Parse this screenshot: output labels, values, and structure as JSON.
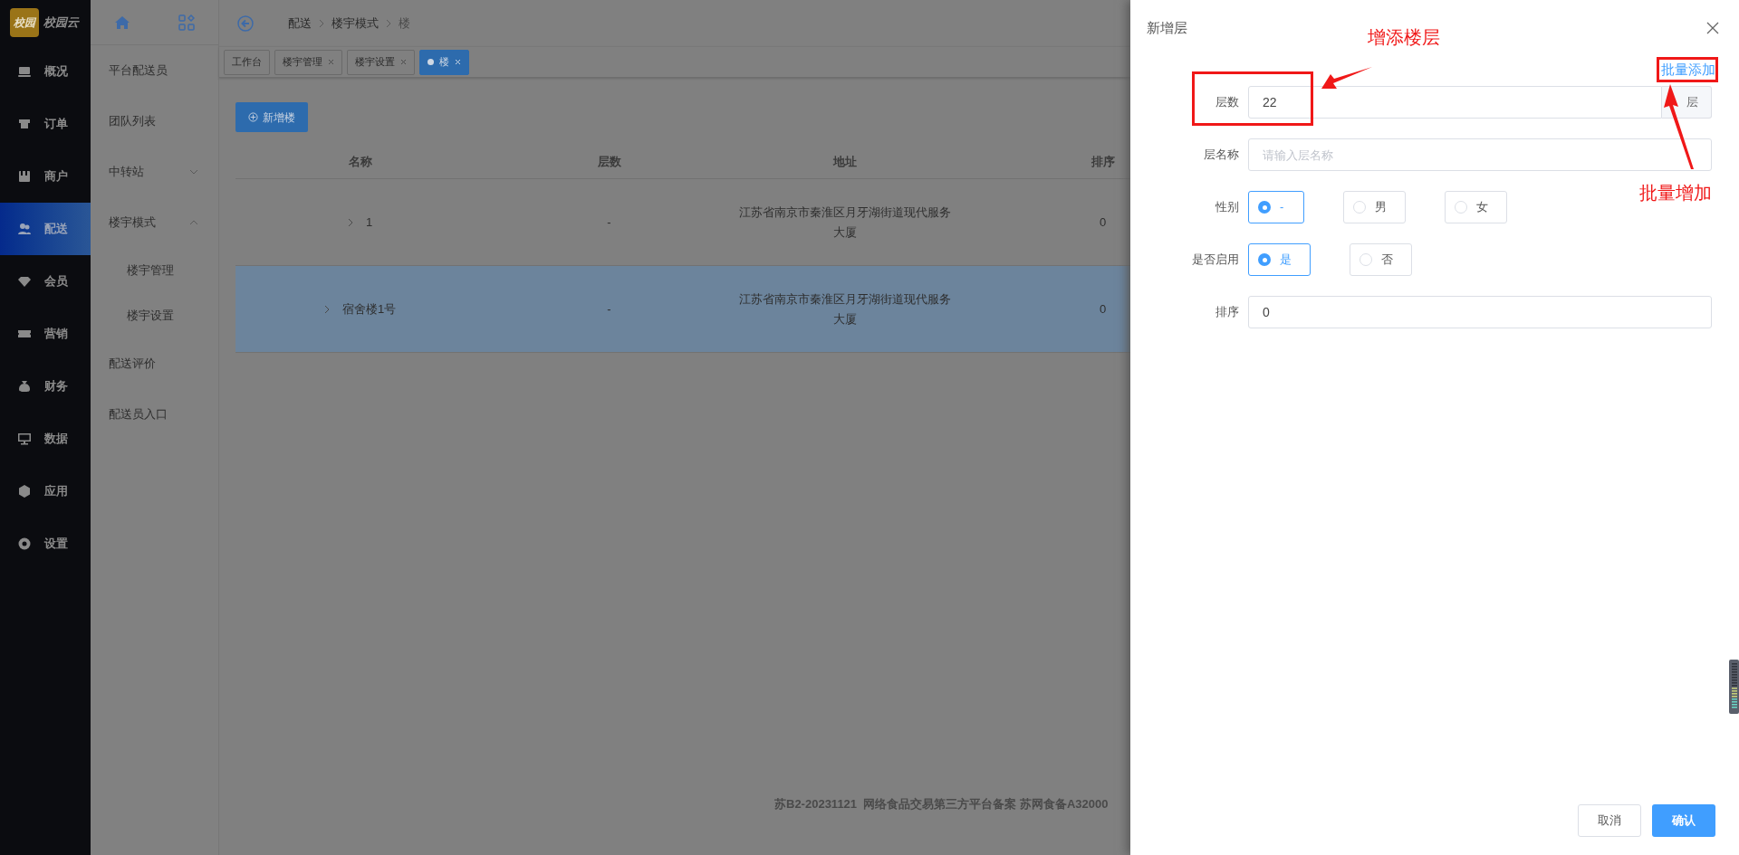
{
  "sidebar": {
    "logo_mark": "校园",
    "logo_text": "校园云",
    "items": [
      {
        "label": "概况",
        "selected": false
      },
      {
        "label": "订单",
        "selected": false
      },
      {
        "label": "商户",
        "selected": false
      },
      {
        "label": "配送",
        "selected": true
      },
      {
        "label": "会员",
        "selected": false
      },
      {
        "label": "营销",
        "selected": false
      },
      {
        "label": "财务",
        "selected": false
      },
      {
        "label": "数据",
        "selected": false
      },
      {
        "label": "应用",
        "selected": false
      },
      {
        "label": "设置",
        "selected": false
      }
    ]
  },
  "submenu": {
    "items": [
      {
        "label": "平台配送员"
      },
      {
        "label": "团队列表"
      },
      {
        "label": "中转站",
        "expanded": false
      },
      {
        "label": "楼宇模式",
        "expanded": true,
        "children": [
          {
            "label": "楼宇管理"
          },
          {
            "label": "楼宇设置"
          }
        ]
      },
      {
        "label": "配送评价"
      },
      {
        "label": "配送员入口"
      }
    ]
  },
  "breadcrumb": [
    "配送",
    "楼宇模式",
    "楼"
  ],
  "tabs": [
    {
      "label": "工作台",
      "selected": false,
      "closable": false
    },
    {
      "label": "楼宇管理",
      "selected": false,
      "closable": true
    },
    {
      "label": "楼宇设置",
      "selected": false,
      "closable": true
    },
    {
      "label": "楼",
      "selected": true,
      "closable": true
    }
  ],
  "add_button": "新增楼",
  "table": {
    "columns": [
      "名称",
      "层数",
      "地址",
      "排序"
    ],
    "rows": [
      {
        "highlighted": false,
        "cells": [
          "1",
          "-",
          "江苏省南京市秦淮区月牙湖街道现代服务大厦",
          "0"
        ]
      },
      {
        "highlighted": true,
        "cells": [
          "宿舍楼1号",
          "-",
          "江苏省南京市秦淮区月牙湖街道现代服务大厦",
          "0"
        ]
      }
    ]
  },
  "footer": "苏B2-20231121  网络食品交易第三方平台备案 苏网食备A32000",
  "drawer": {
    "title": "新增层",
    "batch_link": "批量添加",
    "fields": [
      {
        "kind": "input",
        "label": "层数",
        "value": "22",
        "suffix": "层"
      },
      {
        "kind": "input",
        "label": "层名称",
        "placeholder": "请输入层名称"
      },
      {
        "kind": "radio",
        "label": "性别",
        "options": [
          {
            "label": "-",
            "selected": true
          },
          {
            "label": "男",
            "selected": false
          },
          {
            "label": "女",
            "selected": false
          }
        ]
      },
      {
        "kind": "radio",
        "label": "是否启用",
        "options": [
          {
            "label": "是",
            "selected": true
          },
          {
            "label": "否",
            "selected": false
          }
        ]
      },
      {
        "kind": "input",
        "label": "排序",
        "value": "0"
      }
    ],
    "buttons": [
      {
        "label": "取消",
        "kind": "secondary"
      },
      {
        "label": "确认",
        "kind": "primary"
      }
    ]
  },
  "annotations": [
    "增添楼层",
    "批量增加"
  ]
}
